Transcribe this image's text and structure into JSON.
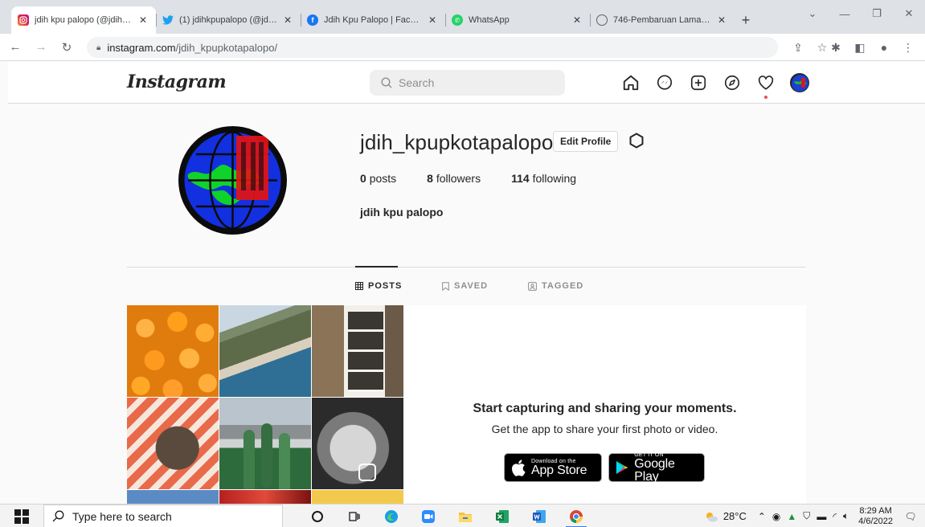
{
  "browser": {
    "tabs": [
      {
        "title": "jdih kpu palopo (@jdih_kp",
        "icon": "instagram-icon",
        "color": "#d6249f",
        "active": true
      },
      {
        "title": "(1) jdihkpupalopo (@jdihk",
        "icon": "twitter-icon",
        "color": "#1da1f2",
        "active": false
      },
      {
        "title": "Jdih Kpu Palopo | Facebo",
        "icon": "facebook-icon",
        "color": "#1877f2",
        "active": false
      },
      {
        "title": "WhatsApp",
        "icon": "whatsapp-icon",
        "color": "#25d366",
        "active": false
      },
      {
        "title": "746-Pembaruan Laman JI",
        "icon": "globe-icon",
        "color": "#5f6368",
        "active": false
      }
    ],
    "url_host": "instagram.com",
    "url_path": "/jdih_kpupkotapalopo/"
  },
  "instagram": {
    "logo_text": "Instagram",
    "search_placeholder": "Search"
  },
  "profile": {
    "username": "jdih_kpupkotapalopo",
    "edit_label": "Edit Profile",
    "posts_count": "0",
    "posts_label": "posts",
    "followers_count": "8",
    "followers_label": "followers",
    "following_count": "114",
    "following_label": "following",
    "full_name": "jdih kpu palopo"
  },
  "profile_tabs": {
    "posts": "POSTS",
    "saved": "SAVED",
    "tagged": "TAGGED"
  },
  "empty_state": {
    "title": "Start capturing and sharing your moments.",
    "subtitle": "Get the app to share your first photo or video.",
    "appstore_small": "Download on the",
    "appstore_big": "App Store",
    "googleplay_small": "GET IT ON",
    "googleplay_big": "Google Play"
  },
  "taskbar": {
    "search_placeholder": "Type here to search",
    "temperature": "28°C",
    "time": "8:29 AM",
    "date": "4/6/2022"
  }
}
